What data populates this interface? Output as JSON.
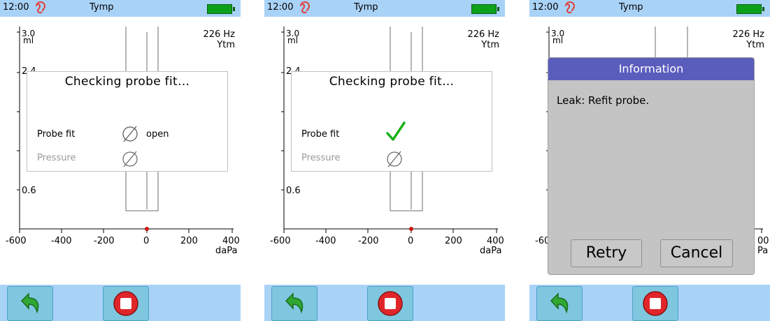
{
  "screens": [
    {
      "status": {
        "time": "12:00",
        "title": "Tymp"
      },
      "frequency": "226 Hz",
      "mode": "Ytm",
      "y_ticks": {
        "top": "3.0",
        "unit": "ml",
        "t24": "2.4",
        "t06": "0.6"
      },
      "x_ticks": [
        "-600",
        "-400",
        "-200",
        "0",
        "200",
        "400"
      ],
      "x_unit": "daPa",
      "dialog": {
        "title": "Checking probe fit…",
        "probe_label": "Probe fit",
        "probe_status": "open",
        "pressure_label": "Pressure"
      }
    },
    {
      "status": {
        "time": "12:00",
        "title": "Tymp"
      },
      "frequency": "226 Hz",
      "mode": "Ytm",
      "y_ticks": {
        "top": "3.0",
        "unit": "ml",
        "t24": "2.4",
        "t06": "0.6"
      },
      "x_ticks": [
        "-600",
        "-400",
        "-200",
        "0",
        "200",
        "400"
      ],
      "x_unit": "daPa",
      "dialog": {
        "title": "Checking probe fit…",
        "probe_label": "Probe fit",
        "pressure_label": "Pressure"
      }
    },
    {
      "status": {
        "time": "12:00",
        "title": "Tymp"
      },
      "frequency": "226 Hz",
      "mode": "Ytm",
      "y_ticks": {
        "top": "3.0",
        "unit": "ml"
      },
      "x_ticks_left": "-60",
      "x_ticks_right": "00",
      "x_unit_right": "Pa",
      "info": {
        "title": "Information",
        "message": "Leak: Refit probe.",
        "retry": "Retry",
        "cancel": "Cancel"
      }
    }
  ],
  "colors": {
    "statusbar": "#a9d2f7",
    "battery": "#0da01a",
    "check": "#19b019",
    "info_header": "#5b5dbd",
    "marker": "#cc1111"
  },
  "icons": [
    "ear-icon",
    "battery-icon",
    "back-arrow-icon",
    "stop-icon",
    "empty-set-icon",
    "checkmark-icon"
  ]
}
